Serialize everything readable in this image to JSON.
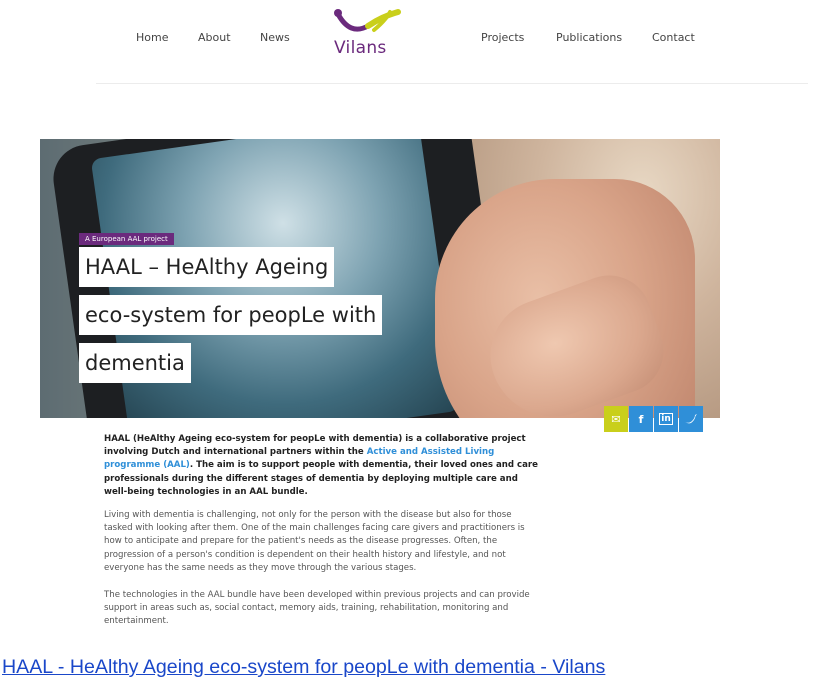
{
  "nav": {
    "left_items": [
      {
        "label": "Home"
      },
      {
        "label": "About"
      },
      {
        "label": "News"
      }
    ],
    "right_items": [
      {
        "label": "Projects"
      },
      {
        "label": "Publications"
      },
      {
        "label": "Contact"
      }
    ],
    "logo_text": "Vilans"
  },
  "hero": {
    "tag": "A European AAL project",
    "title_lines": [
      "HAAL – HeAlthy Ageing",
      "eco-system for peopLe with",
      "dementia"
    ]
  },
  "share": {
    "icons": [
      "mail-icon",
      "facebook-icon",
      "linkedin-icon",
      "twitter-icon"
    ],
    "glyphs": [
      "✉",
      "f",
      "in",
      "✓"
    ]
  },
  "article": {
    "intro_before_link": "HAAL (HeAlthy Ageing eco-system for peopLe with dementia) is a collaborative project involving Dutch and international partners within the ",
    "intro_link": "Active and Assisted Living programme (AAL)",
    "intro_after_link": ". The aim is to support people with dementia, their loved ones and care professionals during the different stages of dementia by deploying multiple care and well-being technologies in an AAL bundle.",
    "paragraph_1": "Living with dementia is challenging, not only for the person with the disease but also for those tasked with looking after them. One of the main challenges facing care givers and practitioners is how to anticipate and prepare for the patient's needs as the disease progresses. Often, the progression of a person's condition is dependent on their health history and lifestyle, and not everyone has the same needs as they move through the various stages.",
    "paragraph_2": "The technologies in the AAL bundle have been developed within previous projects and can provide support in areas such as, social contact, memory aids, training, rehabilitation, monitoring and entertainment."
  },
  "caption": {
    "link_text": "HAAL - HeAlthy Ageing eco-system for peopLe with dementia - Vilans"
  },
  "colors": {
    "brand_purple": "#6b2a7d",
    "brand_lime": "#c9cf1b",
    "link_blue": "#2f8fd8",
    "caption_blue": "#1a47c9"
  }
}
